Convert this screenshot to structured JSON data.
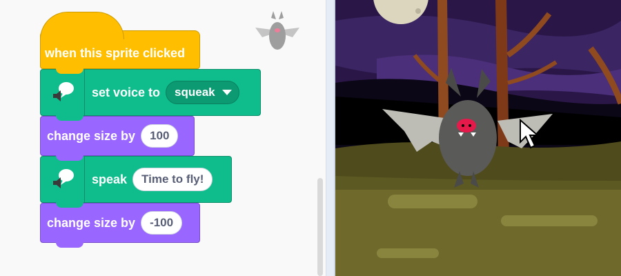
{
  "code_area": {
    "hat_block": {
      "label": "when this sprite clicked"
    },
    "set_voice_block": {
      "label": "set voice to",
      "voice_value": "squeak"
    },
    "change_size_block_1": {
      "label": "change size by",
      "value": "100"
    },
    "speak_block": {
      "label": "speak",
      "text_value": "Time to fly!"
    },
    "change_size_block_2": {
      "label": "change size by",
      "value": "-100"
    }
  },
  "colors": {
    "event_block": "#ffbf00",
    "text2speech_block": "#0fbd8c",
    "looks_block": "#9966ff",
    "stage_sky": "#2a1748"
  },
  "icons": [
    "speech-bubble-speaker-icon",
    "dropdown-arrow-icon",
    "mouse-cursor-icon",
    "bat-sprite-icon"
  ]
}
